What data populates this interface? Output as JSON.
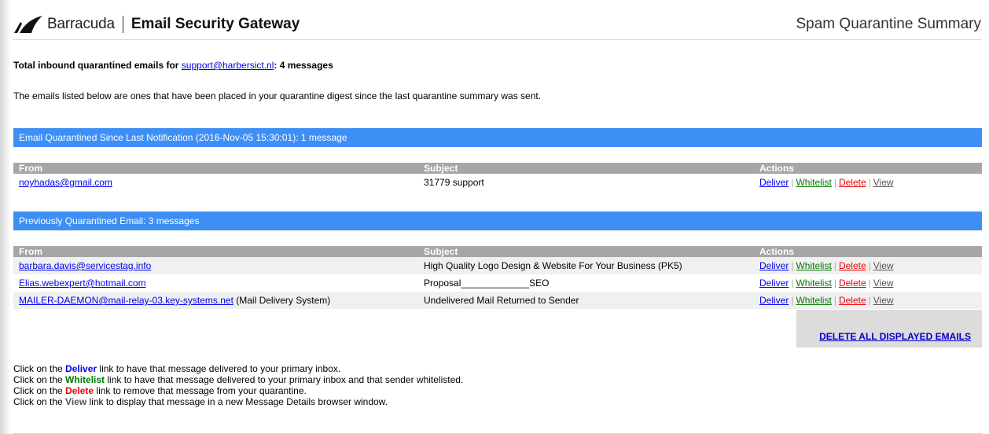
{
  "header": {
    "brand": "Barracuda",
    "product": "Email Security Gateway",
    "page_title": "Spam Quarantine Summary"
  },
  "summary": {
    "prefix": "Total inbound quarantined emails for ",
    "email": "support@harbersict.nl",
    "suffix": ": 4 messages"
  },
  "intro": "The emails listed below are ones that have been placed in your quarantine digest since the last quarantine summary was sent.",
  "columns": {
    "from": "From",
    "subject": "Subject",
    "actions": "Actions"
  },
  "actions": {
    "deliver": "Deliver",
    "whitelist": "Whitelist",
    "delete": "Delete",
    "view": "View",
    "separator": "|"
  },
  "recent": {
    "title": "Email Quarantined Since Last Notification (2016-Nov-05 15:30:01): 1 message",
    "rows": [
      {
        "from": "noyhadas@gmail.com",
        "from_extra": "",
        "subject": "31779 support"
      }
    ]
  },
  "previous": {
    "title": "Previously Quarantined Email: 3 messages",
    "rows": [
      {
        "from": "barbara.davis@servicestag.info",
        "from_extra": "",
        "subject": "High Quality Logo Design & Website For Your Business (PK5)"
      },
      {
        "from": "Elias.webexpert@hotmail.com",
        "from_extra": "",
        "subject": "Proposal_____________SEO"
      },
      {
        "from": "MAILER-DAEMON@mail-relay-03.key-systems.net",
        "from_extra": " (Mail Delivery System)",
        "subject": "Undelivered Mail Returned to Sender"
      }
    ]
  },
  "delete_all": "DELETE ALL DISPLAYED EMAILS",
  "help": {
    "click_on_the": "Click on the ",
    "deliver_word": "Deliver",
    "deliver_rest": " link to have that message delivered to your primary inbox.",
    "whitelist_word": "Whitelist",
    "whitelist_rest": " link to have that message delivered to your primary inbox and that sender whitelisted.",
    "delete_word": "Delete",
    "delete_rest": " link to remove that message from your quarantine.",
    "view_word": "View",
    "view_rest": " link to display that message in a new Message Details browser window."
  },
  "colors": {
    "band": "#3d8ff5",
    "table_header": "#a6a6a6",
    "whitelist": "#007a00",
    "delete": "#ee0000"
  }
}
